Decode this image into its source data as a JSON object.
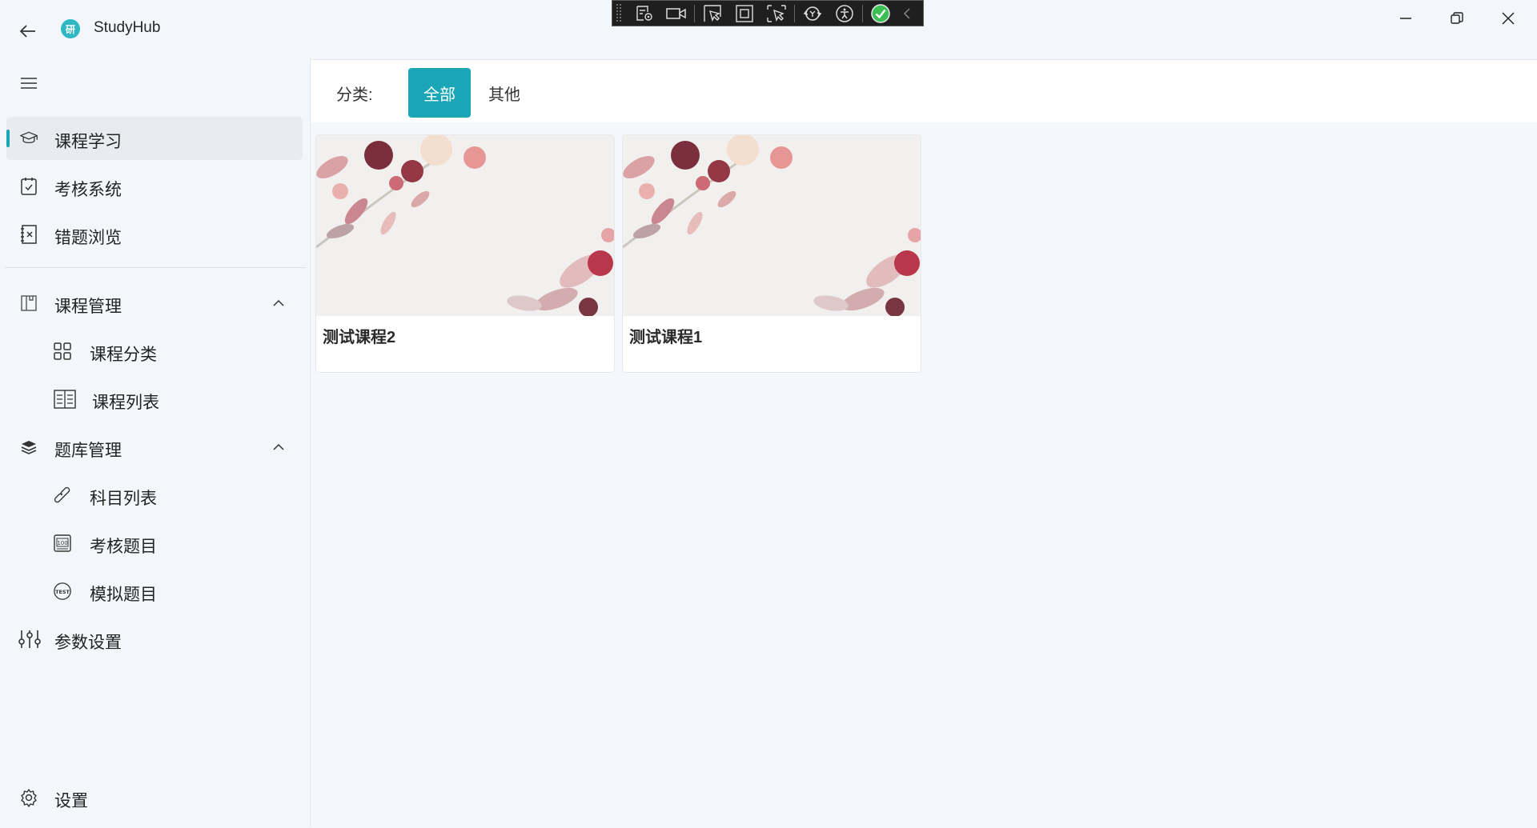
{
  "app": {
    "title": "StudyHub",
    "logo_text": "研"
  },
  "window_controls": {
    "minimize": "minimize",
    "maximize": "restore",
    "close": "close"
  },
  "toolbar": {
    "icons": [
      "record-settings-icon",
      "camera-icon",
      "select-pointer-icon",
      "frame-icon",
      "region-icon",
      "sync-icon",
      "accessibility-icon",
      "check-icon",
      "collapse-icon"
    ]
  },
  "sidebar": {
    "items": [
      {
        "label": "课程学习",
        "icon": "graduation-cap-icon",
        "active": true
      },
      {
        "label": "考核系统",
        "icon": "checklist-icon"
      },
      {
        "label": "错题浏览",
        "icon": "notebook-icon"
      }
    ],
    "groups": [
      {
        "label": "课程管理",
        "icon": "layout-icon",
        "expanded": true,
        "children": [
          {
            "label": "课程分类",
            "icon": "grid-icon"
          },
          {
            "label": "课程列表",
            "icon": "list-icon"
          }
        ]
      },
      {
        "label": "题库管理",
        "icon": "layers-icon",
        "expanded": true,
        "children": [
          {
            "label": "科目列表",
            "icon": "link-icon"
          },
          {
            "label": "考核题目",
            "icon": "score-100-icon"
          },
          {
            "label": "模拟题目",
            "icon": "test-badge-icon"
          }
        ]
      }
    ],
    "params": {
      "label": "参数设置",
      "icon": "sliders-icon"
    },
    "settings": {
      "label": "设置",
      "icon": "gear-icon"
    }
  },
  "filter": {
    "label": "分类:",
    "chips": [
      {
        "label": "全部",
        "selected": true
      },
      {
        "label": "其他",
        "selected": false
      }
    ]
  },
  "courses": [
    {
      "title": "测试课程2"
    },
    {
      "title": "测试课程1"
    }
  ],
  "colors": {
    "accent": "#1aa6b7",
    "logo": "#2fb8c4",
    "background": "#f3f7fb"
  }
}
